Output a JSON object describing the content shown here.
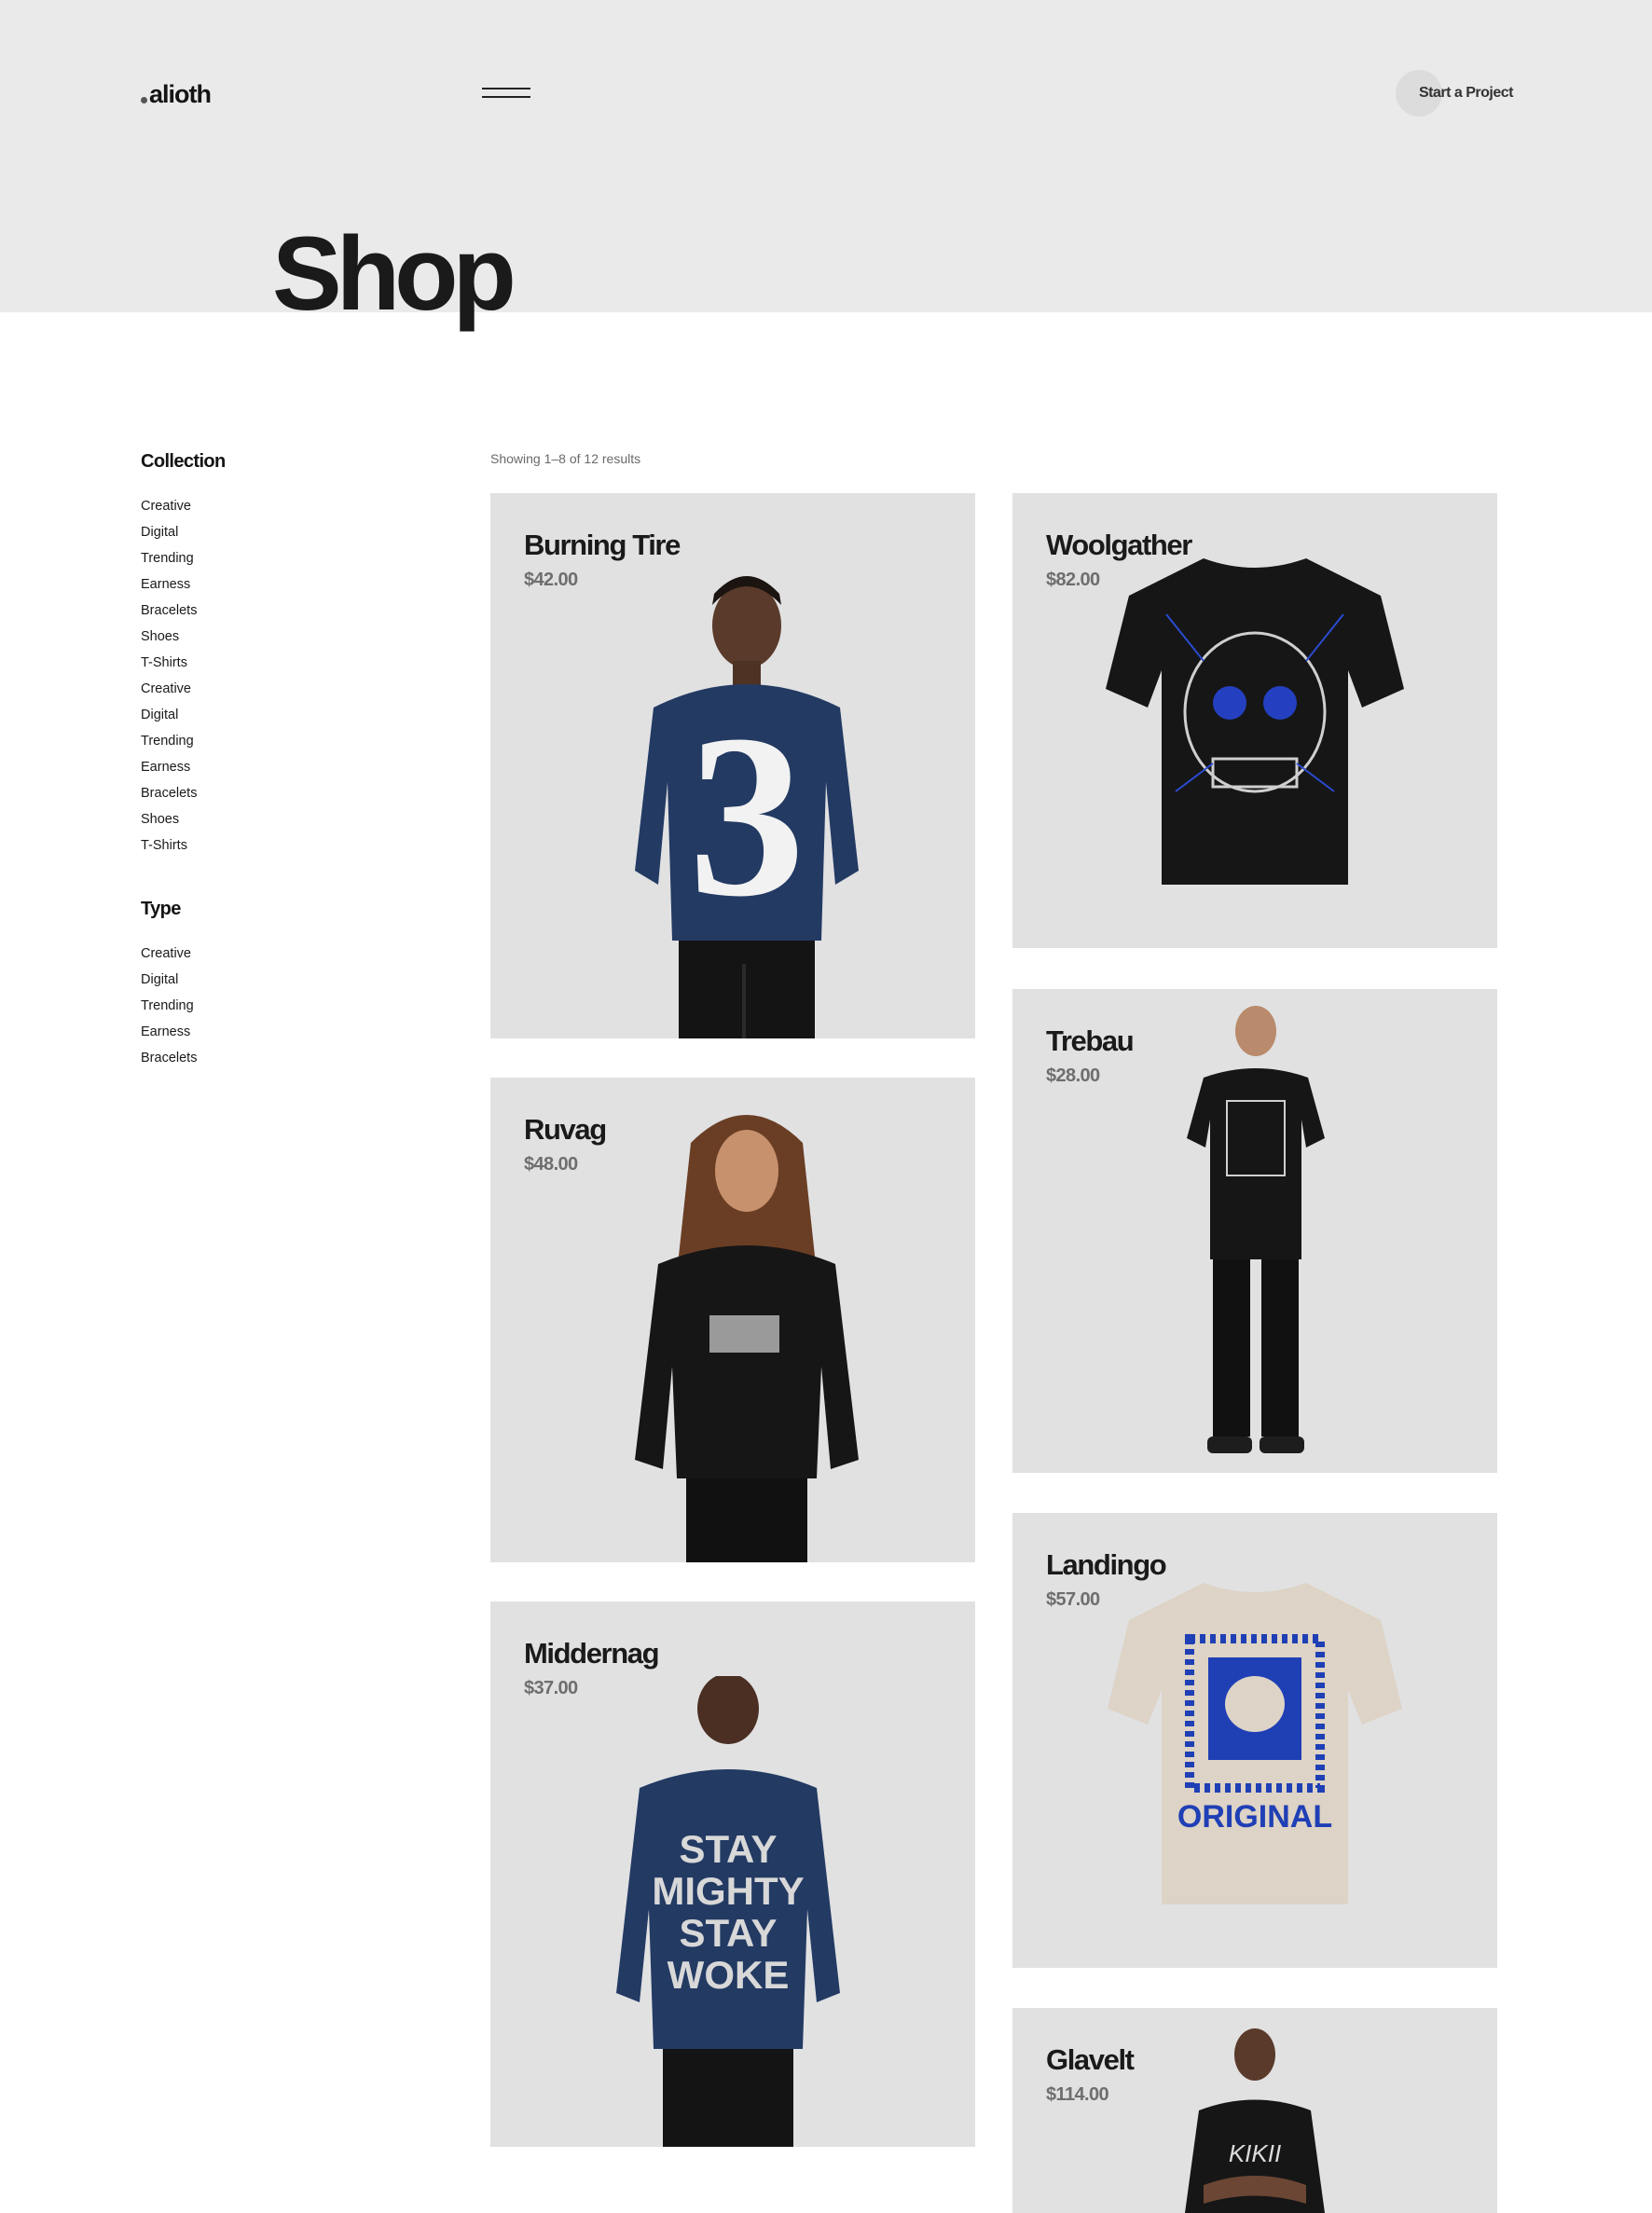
{
  "header": {
    "logo": "alioth",
    "cta_label": "Start a Project",
    "page_title": "Shop"
  },
  "sidebar": {
    "collection": {
      "heading": "Collection",
      "items": [
        "Creative",
        "Digital",
        "Trending",
        "Earness",
        "Bracelets",
        "Shoes",
        "T-Shirts",
        "Creative",
        "Digital",
        "Trending",
        "Earness",
        "Bracelets",
        "Shoes",
        "T-Shirts"
      ]
    },
    "type": {
      "heading": "Type",
      "items": [
        "Creative",
        "Digital",
        "Trending",
        "Earness",
        "Bracelets"
      ]
    }
  },
  "results_text": "Showing 1–8 of 12 results",
  "products": [
    {
      "title": "Burning Tire",
      "price": "$42.00"
    },
    {
      "title": "Woolgather",
      "price": "$82.00"
    },
    {
      "title": "Ruvag",
      "price": "$48.00"
    },
    {
      "title": "Trebau",
      "price": "$28.00"
    },
    {
      "title": "Middernag",
      "price": "$37.00"
    },
    {
      "title": "Landingo",
      "price": "$57.00"
    },
    {
      "title": "Glavelt",
      "price": "$114.00"
    }
  ],
  "colors": {
    "hero_bg": "#eaeaea",
    "card_bg": "#e1e1e2",
    "navy": "#233a63",
    "black": "#151515",
    "beige": "#ddd3c6",
    "print_blue": "#1f3fb5"
  }
}
